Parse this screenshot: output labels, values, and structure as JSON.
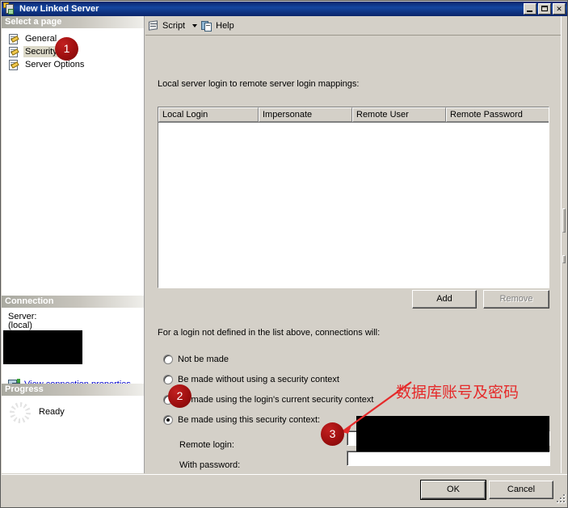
{
  "window": {
    "title": "New Linked Server",
    "icon": "linked-server-icon",
    "buttons": {
      "minimize": "Minimize",
      "maximize": "Maximize",
      "close": "Close"
    }
  },
  "sidebar": {
    "select_page_header": "Select a page",
    "pages": [
      {
        "label": "General",
        "selected": false
      },
      {
        "label": "Security",
        "selected": true
      },
      {
        "label": "Server Options",
        "selected": false
      }
    ],
    "connection": {
      "header": "Connection",
      "server_label": "Server:",
      "server_value": "(local)",
      "redacted": true,
      "view_properties_link": "View connection properties",
      "view_properties_icon": "connection-properties-icon"
    },
    "progress": {
      "header": "Progress",
      "status": "Ready",
      "spinner_icon": "progress-spinner-icon"
    }
  },
  "toolbar": {
    "script_label": "Script",
    "script_icon": "script-icon",
    "script_dropdown_icon": "chevron-down-icon",
    "help_label": "Help",
    "help_icon": "help-icon"
  },
  "main": {
    "mappings_label": "Local server login to remote server login mappings:",
    "grid": {
      "columns": [
        "Local Login",
        "Impersonate",
        "Remote User",
        "Remote Password"
      ],
      "rows": []
    },
    "add_button": "Add",
    "remove_button": "Remove",
    "remove_disabled": true,
    "fallback_label": "For a login not defined in the list above, connections will:",
    "options": [
      {
        "label": "Not be made",
        "checked": false
      },
      {
        "label": "Be made without using a security context",
        "checked": false
      },
      {
        "label": "Be made using the login's current security context",
        "checked": false
      },
      {
        "label": "Be made using this security context:",
        "checked": true
      }
    ],
    "remote_login_label": "Remote login:",
    "remote_login_value": "",
    "with_password_label": "With password:",
    "with_password_value": "",
    "credentials_redacted": true
  },
  "footer": {
    "ok_button": "OK",
    "cancel_button": "Cancel",
    "resize_grip_icon": "resize-grip-icon"
  },
  "annotations": {
    "badges": [
      {
        "number": "1"
      },
      {
        "number": "2"
      },
      {
        "number": "3"
      }
    ],
    "note_text": "数据库账号及密码",
    "note_color": "#e52a2a",
    "arrow_icon": "annotation-arrow-icon"
  }
}
